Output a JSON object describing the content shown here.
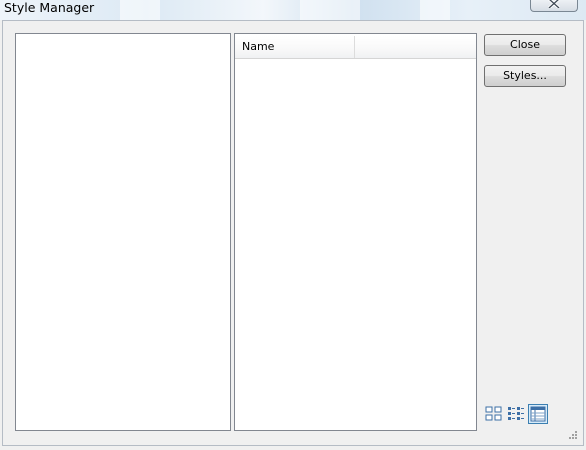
{
  "window": {
    "title": "Style Manager"
  },
  "list": {
    "columns": [
      "Name",
      ""
    ]
  },
  "buttons": {
    "close": "Close",
    "styles": "Styles..."
  },
  "view_modes": [
    {
      "icon": "large-icons-icon",
      "selected": false
    },
    {
      "icon": "list-view-icon",
      "selected": false
    },
    {
      "icon": "details-view-icon",
      "selected": true
    }
  ],
  "icons": {
    "window_close": "close-icon",
    "resize": "resize-grip-icon"
  }
}
